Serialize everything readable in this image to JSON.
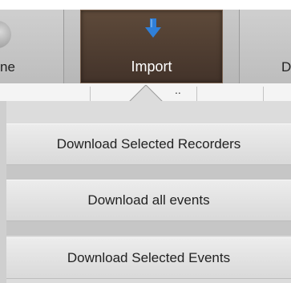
{
  "toolbar": {
    "left_label": "ne",
    "import_label": "Import",
    "right_label": "D",
    "import_icon": "download-arrow-icon",
    "accent_color": "#2f7fd8"
  },
  "tabstrip": {
    "ellipsis": ".."
  },
  "menu": {
    "items": [
      {
        "label": "Download Selected Recorders"
      },
      {
        "label": "Download all events"
      },
      {
        "label": "Download Selected Events"
      }
    ]
  }
}
